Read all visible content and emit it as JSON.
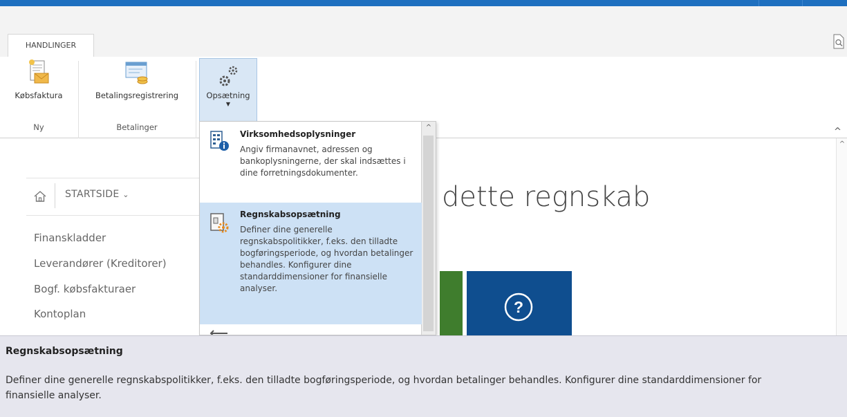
{
  "ribbon": {
    "tab": "HANDLINGER",
    "buttons": {
      "kobsfaktura": "Købsfaktura",
      "betalingsregistrering": "Betalingsregistrering",
      "opsaetning": "Opsætning"
    },
    "groups": {
      "ny": "Ny",
      "betalinger": "Betalinger"
    }
  },
  "nav": {
    "home": "STARTSIDE",
    "items": [
      "Finanskladder",
      "Leverandører (Kreditorer)",
      "Bogf. købsfakturaer",
      "Kontoplan"
    ]
  },
  "main": {
    "title": "dette regnskab"
  },
  "dropdown": {
    "items": [
      {
        "title": "Virksomhedsoplysninger",
        "desc": "Angiv firmanavnet, adressen og bankoplysningerne, der skal indsættes i dine forretningsdokumenter."
      },
      {
        "title": "Regnskabsopsætning",
        "desc": "Definer dine generelle regnskabspolitikker, f.eks. den tilladte bogføringsperiode, og hvordan betalinger behandles. Konfigurer dine standarddimensioner for finansielle analyser."
      }
    ]
  },
  "tooltip": {
    "title": "Regnskabsopsætning",
    "desc": "Definer dine generelle regnskabspolitikker, f.eks. den tilladte bogføringsperiode, og hvordan betalinger behandles. Konfigurer dine standarddimensioner for finansielle analyser."
  },
  "colors": {
    "accent": "#1e6fbf",
    "tile_green": "#3f7d2d",
    "tile_blue": "#0f4e8f",
    "highlight": "#cde1f5"
  }
}
